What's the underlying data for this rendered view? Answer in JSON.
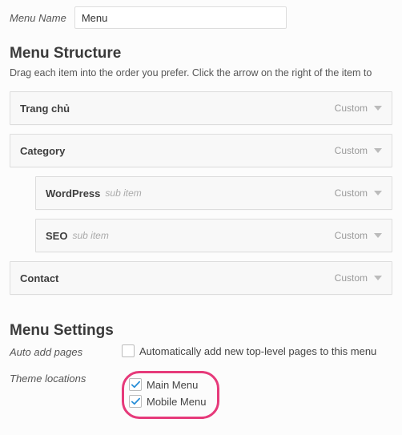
{
  "menu_name_label": "Menu Name",
  "menu_name_value": "Menu",
  "structure": {
    "title": "Menu Structure",
    "hint": "Drag each item into the order you prefer. Click the arrow on the right of the item to",
    "type_label": "Custom",
    "sub_item_label": "sub item",
    "items": [
      {
        "title": "Trang chủ",
        "depth": 0,
        "sub": false
      },
      {
        "title": "Category",
        "depth": 0,
        "sub": false
      },
      {
        "title": "WordPress",
        "depth": 1,
        "sub": true
      },
      {
        "title": "SEO",
        "depth": 1,
        "sub": true
      },
      {
        "title": "Contact",
        "depth": 0,
        "sub": false
      }
    ]
  },
  "settings": {
    "title": "Menu Settings",
    "auto_add_label": "Auto add pages",
    "auto_add_text": "Automatically add new top-level pages to this menu",
    "auto_add_checked": false,
    "locations_label": "Theme locations",
    "locations": [
      {
        "label": "Main Menu",
        "checked": true
      },
      {
        "label": "Mobile Menu",
        "checked": true
      }
    ]
  }
}
